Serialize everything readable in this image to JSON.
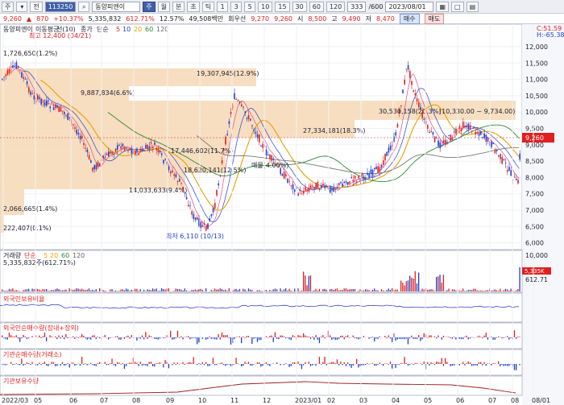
{
  "toolbar": {
    "items": [
      "주",
      "▾",
      "전",
      "113250"
    ],
    "stock_name": "동양피엔이",
    "period_buttons": [
      "주",
      "월",
      "분",
      "초",
      "틱",
      "1",
      "3",
      "5",
      "10",
      "15",
      "30",
      "60",
      "120"
    ],
    "count": "333",
    "count_total": "/600",
    "date": "2023/08/01",
    "right_buttons": [
      "□",
      "▤"
    ]
  },
  "quote": {
    "price": "9,260",
    "change_arrow": "▲",
    "change": "870",
    "change_pct": "+10.37%",
    "volume": "5,335,832",
    "vol_ratio": "612.71%",
    "turnover": "12.57%",
    "amount": "49,508백만",
    "tag": "회우선",
    "open": "9,270",
    "open2": "9,260",
    "high_label": "시",
    "high": "8,500",
    "low_label": "고",
    "low": "9,490",
    "close_label": "저",
    "close": "8,470",
    "buy": "매수",
    "sell": "매도"
  },
  "price_panel": {
    "legend": [
      "동양피엔이",
      "이동평균",
      "선(10)"
    ],
    "ma_legend": [
      "종가",
      "단순",
      "5",
      "10",
      "20",
      "60",
      "120"
    ],
    "right_top": [
      "C:51.59",
      "H:-65.38"
    ],
    "high_marker": "최고 12,400 (04/21)",
    "low_marker": "최저 6,110 (10/13)",
    "current": "9,260",
    "yaxis": [
      "12,000",
      "11,500",
      "11,000",
      "10,500",
      "10,000",
      "9,500",
      "9,000",
      "8,500",
      "8,000",
      "7,500",
      "7,000",
      "6,500",
      "6,000"
    ],
    "profile_labels": [
      "1,726,650(1.2%)",
      "19,307,945(12.9%)",
      "9,887,834(6.6%)",
      "30,530,158(20.3%)",
      "(10,330.00 ~ 9,734.00)",
      "27,334,181(18.3%)",
      "17,446,602(11.7%)",
      "18,620,141(12.5%)",
      "매물(4.00%)",
      "14,033,633(9.4%)",
      "2,066,665(1.4%)",
      "222,407(0.1%)"
    ]
  },
  "volume_panel": {
    "legend": [
      "거래량",
      "단순",
      "5",
      "20",
      "60",
      "120"
    ],
    "value": "5,335,832주(612.71%)",
    "yaxis": [
      "10,000",
      "5,335K",
      "612.71"
    ]
  },
  "panels": {
    "p3": "외국인보유비율",
    "p4": "외국인순매수량(장내+장외)",
    "p5": "기관순매수량(거래소)",
    "p6": "기관보유수량"
  },
  "xaxis": [
    "2022/03",
    "05",
    "06",
    "07",
    "08",
    "09",
    "10",
    "11",
    "12",
    "2023/01",
    "02",
    "03",
    "04",
    "05",
    "06",
    "07",
    "08",
    "08/01"
  ]
}
